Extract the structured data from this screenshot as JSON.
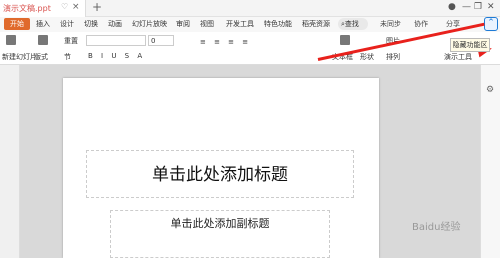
{
  "titlebar": {
    "doc_name": "演示文稿.ppt",
    "pin": "♡",
    "close": "×",
    "new_tab": "+"
  },
  "ribbon_tabs": [
    "插入",
    "设计",
    "切换",
    "动画",
    "幻灯片放映",
    "审阅",
    "视图",
    "开发工具",
    "特色功能",
    "稻壳资源"
  ],
  "start_label": "开始",
  "search_label": "查找",
  "right_tabs": {
    "sync": "未同步",
    "collab": "协作",
    "share": "分享"
  },
  "toolbar": {
    "new_slide": "新建幻灯片",
    "layout": "版式",
    "reset": "重置",
    "section": "节",
    "size": "0",
    "textbox": "文本框",
    "shape": "形状",
    "arrange": "排列",
    "picture": "图片",
    "presenter": "演示工具"
  },
  "tooltip": "隐藏功能区",
  "slide": {
    "title": "单击此处添加标题",
    "subtitle": "单击此处添加副标题"
  },
  "watermark": "Baidu经验"
}
